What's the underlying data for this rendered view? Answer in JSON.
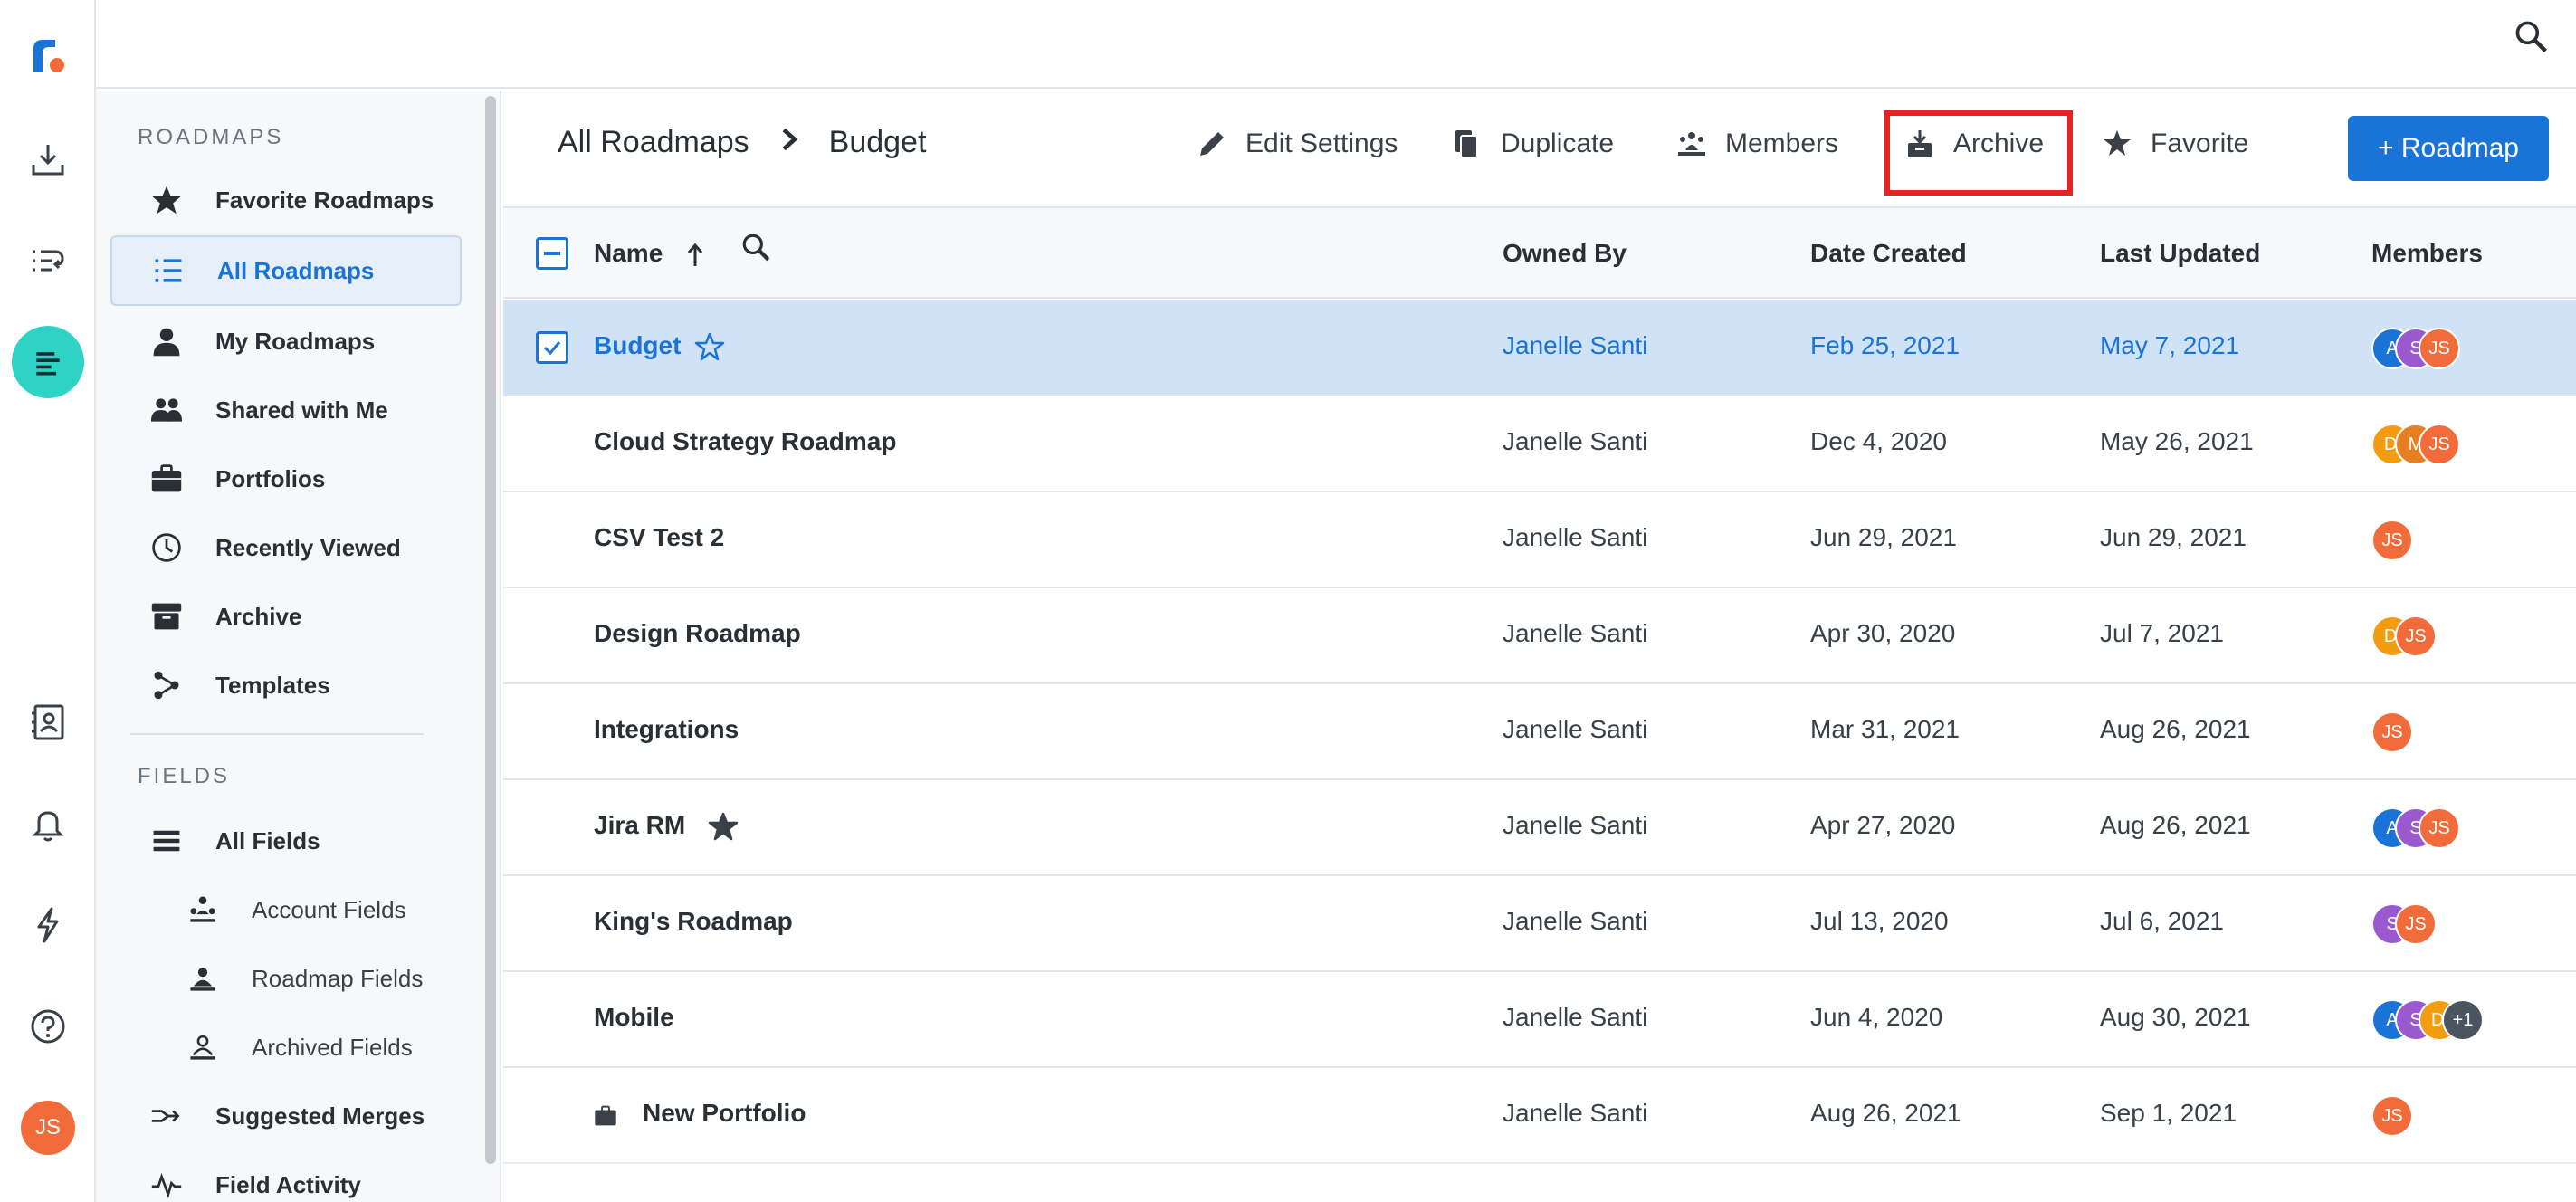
{
  "rail": {
    "avatar": "JS"
  },
  "sidebar": {
    "roadmaps_heading": "ROADMAPS",
    "fields_heading": "FIELDS",
    "roadmap_items": [
      {
        "label": "Favorite Roadmaps",
        "icon": "star-icon"
      },
      {
        "label": "All Roadmaps",
        "icon": "list-icon",
        "active": true
      },
      {
        "label": "My Roadmaps",
        "icon": "person-icon"
      },
      {
        "label": "Shared with Me",
        "icon": "people-icon"
      },
      {
        "label": "Portfolios",
        "icon": "briefcase-icon"
      },
      {
        "label": "Recently Viewed",
        "icon": "clock-icon"
      },
      {
        "label": "Archive",
        "icon": "archive-box-icon"
      },
      {
        "label": "Templates",
        "icon": "templates-icon"
      }
    ],
    "field_items": [
      {
        "label": "All Fields",
        "icon": "fields-icon"
      },
      {
        "label": "Account Fields",
        "icon": "account-fields-icon"
      },
      {
        "label": "Roadmap Fields",
        "icon": "roadmap-fields-icon"
      },
      {
        "label": "Archived Fields",
        "icon": "archived-fields-icon"
      },
      {
        "label": "Suggested Merges",
        "icon": "merge-icon"
      },
      {
        "label": "Field Activity",
        "icon": "activity-icon"
      }
    ]
  },
  "header": {
    "breadcrumb_root": "All Roadmaps",
    "breadcrumb_current": "Budget",
    "actions": {
      "edit_settings": "Edit Settings",
      "duplicate": "Duplicate",
      "members": "Members",
      "archive": "Archive",
      "favorite": "Favorite"
    },
    "add_roadmap": "+ Roadmap"
  },
  "table": {
    "columns": {
      "name": "Name",
      "owned_by": "Owned By",
      "date_created": "Date Created",
      "last_updated": "Last Updated",
      "members": "Members"
    },
    "rows": [
      {
        "name": "Budget",
        "owner": "Janelle Santi",
        "created": "Feb 25, 2021",
        "updated": "May 7, 2021",
        "selected": true,
        "starred": "outline",
        "members": [
          {
            "t": "A",
            "c": "#1a73d6"
          },
          {
            "t": "S",
            "c": "#9b59d0"
          },
          {
            "t": "JS",
            "c": "#f26b3a"
          }
        ]
      },
      {
        "name": "Cloud Strategy Roadmap",
        "owner": "Janelle Santi",
        "created": "Dec 4, 2020",
        "updated": "May 26, 2021",
        "members": [
          {
            "t": "D'",
            "c": "#f39c12"
          },
          {
            "t": "M",
            "c": "#e67e22"
          },
          {
            "t": "JS",
            "c": "#f26b3a"
          }
        ]
      },
      {
        "name": "CSV Test 2",
        "owner": "Janelle Santi",
        "created": "Jun 29, 2021",
        "updated": "Jun 29, 2021",
        "members": [
          {
            "t": "JS",
            "c": "#f26b3a"
          }
        ]
      },
      {
        "name": "Design Roadmap",
        "owner": "Janelle Santi",
        "created": "Apr 30, 2020",
        "updated": "Jul 7, 2021",
        "members": [
          {
            "t": "D'",
            "c": "#f39c12"
          },
          {
            "t": "JS",
            "c": "#f26b3a"
          }
        ]
      },
      {
        "name": "Integrations",
        "owner": "Janelle Santi",
        "created": "Mar 31, 2021",
        "updated": "Aug 26, 2021",
        "members": [
          {
            "t": "JS",
            "c": "#f26b3a"
          }
        ]
      },
      {
        "name": "Jira RM",
        "owner": "Janelle Santi",
        "created": "Apr 27, 2020",
        "updated": "Aug 26, 2021",
        "starred": "filled",
        "members": [
          {
            "t": "A",
            "c": "#1a73d6"
          },
          {
            "t": "S",
            "c": "#9b59d0"
          },
          {
            "t": "JS",
            "c": "#f26b3a"
          }
        ]
      },
      {
        "name": "King's Roadmap",
        "owner": "Janelle Santi",
        "created": "Jul 13, 2020",
        "updated": "Jul 6, 2021",
        "members": [
          {
            "t": "S",
            "c": "#9b59d0"
          },
          {
            "t": "JS",
            "c": "#f26b3a"
          }
        ]
      },
      {
        "name": "Mobile",
        "owner": "Janelle Santi",
        "created": "Jun 4, 2020",
        "updated": "Aug 30, 2021",
        "members": [
          {
            "t": "A",
            "c": "#1a73d6"
          },
          {
            "t": "S",
            "c": "#9b59d0"
          },
          {
            "t": "D'",
            "c": "#f39c12"
          },
          {
            "t": "+1",
            "c": "#4a5560"
          }
        ]
      },
      {
        "name": "New Portfolio",
        "owner": "Janelle Santi",
        "created": "Aug 26, 2021",
        "updated": "Sep 1, 2021",
        "portfolio": true,
        "members": [
          {
            "t": "JS",
            "c": "#f26b3a"
          }
        ]
      }
    ]
  },
  "colors": {
    "accent": "#1a73d6",
    "highlight_box": "#e5231f",
    "active_rail": "#2ed3c6",
    "selected_row": "#cfe2f6"
  }
}
